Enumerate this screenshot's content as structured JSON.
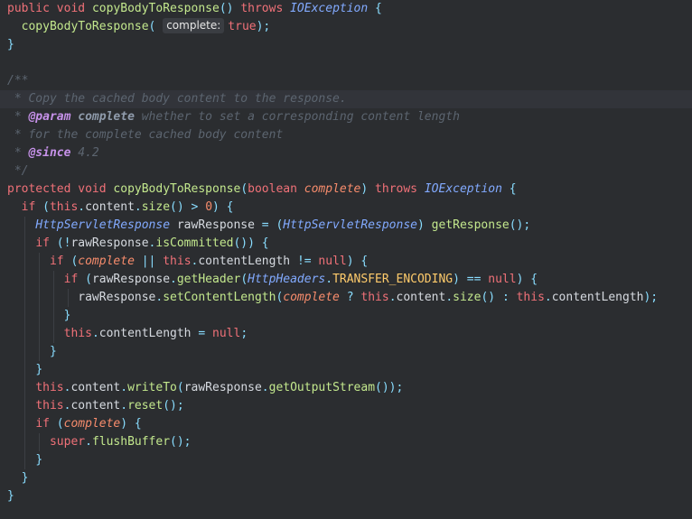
{
  "editor": {
    "theme_colors": {
      "background": "#2b2d30",
      "keyword": "#f07178",
      "method": "#c3e88d",
      "type": "#82aaff",
      "comment": "#5c6570",
      "javadoc_tag": "#c792ea"
    },
    "lines": [
      {
        "indent": 0,
        "tokens": [
          {
            "c": "kw",
            "t": "public"
          },
          {
            "c": "",
            "t": " "
          },
          {
            "c": "kw",
            "t": "void"
          },
          {
            "c": "",
            "t": " "
          },
          {
            "c": "fn",
            "t": "copyBodyToResponse"
          },
          {
            "c": "pu",
            "t": "()"
          },
          {
            "c": "",
            "t": " "
          },
          {
            "c": "kw",
            "t": "throws"
          },
          {
            "c": "",
            "t": " "
          },
          {
            "c": "ty",
            "t": "IOException"
          },
          {
            "c": "",
            "t": " "
          },
          {
            "c": "pu",
            "t": "{"
          }
        ]
      },
      {
        "indent": 1,
        "tokens": [
          {
            "c": "fn",
            "t": "copyBodyToResponse"
          },
          {
            "c": "pu",
            "t": "( "
          },
          {
            "c": "hint",
            "t": "complete:"
          },
          {
            "c": "kw",
            "t": "true"
          },
          {
            "c": "pu",
            "t": ");"
          }
        ]
      },
      {
        "indent": 0,
        "tokens": [
          {
            "c": "pu",
            "t": "}"
          }
        ]
      },
      {
        "indent": 0,
        "tokens": []
      },
      {
        "indent": 0,
        "tokens": [
          {
            "c": "cm",
            "t": "/**"
          }
        ]
      },
      {
        "indent": 0,
        "highlight": true,
        "tokens": [
          {
            "c": "cm",
            "t": " * Copy the cached body content to the response."
          }
        ]
      },
      {
        "indent": 0,
        "tokens": [
          {
            "c": "cm",
            "t": " * "
          },
          {
            "c": "tg",
            "t": "@param"
          },
          {
            "c": "",
            "t": " "
          },
          {
            "c": "tp",
            "t": "complete"
          },
          {
            "c": "cm",
            "t": " whether to set a corresponding content length"
          }
        ]
      },
      {
        "indent": 0,
        "tokens": [
          {
            "c": "cm",
            "t": " * for the complete cached body content"
          }
        ]
      },
      {
        "indent": 0,
        "tokens": [
          {
            "c": "cm",
            "t": " * "
          },
          {
            "c": "tg",
            "t": "@since"
          },
          {
            "c": "cm",
            "t": " 4.2"
          }
        ]
      },
      {
        "indent": 0,
        "tokens": [
          {
            "c": "cm",
            "t": " */"
          }
        ]
      },
      {
        "indent": 0,
        "tokens": [
          {
            "c": "kw",
            "t": "protected"
          },
          {
            "c": "",
            "t": " "
          },
          {
            "c": "kw",
            "t": "void"
          },
          {
            "c": "",
            "t": " "
          },
          {
            "c": "fn",
            "t": "copyBodyToResponse"
          },
          {
            "c": "pu",
            "t": "("
          },
          {
            "c": "kw",
            "t": "boolean"
          },
          {
            "c": "",
            "t": " "
          },
          {
            "c": "pr",
            "t": "complete"
          },
          {
            "c": "pu",
            "t": ")"
          },
          {
            "c": "",
            "t": " "
          },
          {
            "c": "kw",
            "t": "throws"
          },
          {
            "c": "",
            "t": " "
          },
          {
            "c": "ty",
            "t": "IOException"
          },
          {
            "c": "",
            "t": " "
          },
          {
            "c": "pu",
            "t": "{"
          }
        ]
      },
      {
        "indent": 1,
        "tokens": [
          {
            "c": "kw",
            "t": "if"
          },
          {
            "c": "",
            "t": " "
          },
          {
            "c": "pu",
            "t": "("
          },
          {
            "c": "kw",
            "t": "this"
          },
          {
            "c": "pu",
            "t": "."
          },
          {
            "c": "id",
            "t": "content"
          },
          {
            "c": "pu",
            "t": "."
          },
          {
            "c": "fn",
            "t": "size"
          },
          {
            "c": "pu",
            "t": "()"
          },
          {
            "c": "",
            "t": " "
          },
          {
            "c": "op",
            "t": ">"
          },
          {
            "c": "",
            "t": " "
          },
          {
            "c": "num",
            "t": "0"
          },
          {
            "c": "pu",
            "t": ")"
          },
          {
            "c": "",
            "t": " "
          },
          {
            "c": "pu",
            "t": "{"
          }
        ]
      },
      {
        "indent": 2,
        "tokens": [
          {
            "c": "ty",
            "t": "HttpServletResponse"
          },
          {
            "c": "",
            "t": " "
          },
          {
            "c": "id",
            "t": "rawResponse"
          },
          {
            "c": "",
            "t": " "
          },
          {
            "c": "op",
            "t": "="
          },
          {
            "c": "",
            "t": " "
          },
          {
            "c": "pu",
            "t": "("
          },
          {
            "c": "ty",
            "t": "HttpServletResponse"
          },
          {
            "c": "pu",
            "t": ")"
          },
          {
            "c": "",
            "t": " "
          },
          {
            "c": "fn",
            "t": "getResponse"
          },
          {
            "c": "pu",
            "t": "();"
          }
        ]
      },
      {
        "indent": 2,
        "tokens": [
          {
            "c": "kw",
            "t": "if"
          },
          {
            "c": "",
            "t": " "
          },
          {
            "c": "pu",
            "t": "("
          },
          {
            "c": "op",
            "t": "!"
          },
          {
            "c": "id",
            "t": "rawResponse"
          },
          {
            "c": "pu",
            "t": "."
          },
          {
            "c": "fn",
            "t": "isCommitted"
          },
          {
            "c": "pu",
            "t": "())"
          },
          {
            "c": "",
            "t": " "
          },
          {
            "c": "pu",
            "t": "{"
          }
        ]
      },
      {
        "indent": 3,
        "tokens": [
          {
            "c": "kw",
            "t": "if"
          },
          {
            "c": "",
            "t": " "
          },
          {
            "c": "pu",
            "t": "("
          },
          {
            "c": "pr",
            "t": "complete"
          },
          {
            "c": "",
            "t": " "
          },
          {
            "c": "op",
            "t": "||"
          },
          {
            "c": "",
            "t": " "
          },
          {
            "c": "kw",
            "t": "this"
          },
          {
            "c": "pu",
            "t": "."
          },
          {
            "c": "id",
            "t": "contentLength"
          },
          {
            "c": "",
            "t": " "
          },
          {
            "c": "op",
            "t": "!="
          },
          {
            "c": "",
            "t": " "
          },
          {
            "c": "kw",
            "t": "null"
          },
          {
            "c": "pu",
            "t": ")"
          },
          {
            "c": "",
            "t": " "
          },
          {
            "c": "pu",
            "t": "{"
          }
        ]
      },
      {
        "indent": 4,
        "tokens": [
          {
            "c": "kw",
            "t": "if"
          },
          {
            "c": "",
            "t": " "
          },
          {
            "c": "pu",
            "t": "("
          },
          {
            "c": "id",
            "t": "rawResponse"
          },
          {
            "c": "pu",
            "t": "."
          },
          {
            "c": "fn",
            "t": "getHeader"
          },
          {
            "c": "pu",
            "t": "("
          },
          {
            "c": "ty",
            "t": "HttpHeaders"
          },
          {
            "c": "pu",
            "t": "."
          },
          {
            "c": "cs",
            "t": "TRANSFER_ENCODING"
          },
          {
            "c": "pu",
            "t": ")"
          },
          {
            "c": "",
            "t": " "
          },
          {
            "c": "op",
            "t": "=="
          },
          {
            "c": "",
            "t": " "
          },
          {
            "c": "kw",
            "t": "null"
          },
          {
            "c": "pu",
            "t": ")"
          },
          {
            "c": "",
            "t": " "
          },
          {
            "c": "pu",
            "t": "{"
          }
        ]
      },
      {
        "indent": 5,
        "tokens": [
          {
            "c": "id",
            "t": "rawResponse"
          },
          {
            "c": "pu",
            "t": "."
          },
          {
            "c": "fn",
            "t": "setContentLength"
          },
          {
            "c": "pu",
            "t": "("
          },
          {
            "c": "pr",
            "t": "complete"
          },
          {
            "c": "",
            "t": " "
          },
          {
            "c": "op",
            "t": "?"
          },
          {
            "c": "",
            "t": " "
          },
          {
            "c": "kw",
            "t": "this"
          },
          {
            "c": "pu",
            "t": "."
          },
          {
            "c": "id",
            "t": "content"
          },
          {
            "c": "pu",
            "t": "."
          },
          {
            "c": "fn",
            "t": "size"
          },
          {
            "c": "pu",
            "t": "()"
          },
          {
            "c": "",
            "t": " "
          },
          {
            "c": "op",
            "t": ":"
          },
          {
            "c": "",
            "t": " "
          },
          {
            "c": "kw",
            "t": "this"
          },
          {
            "c": "pu",
            "t": "."
          },
          {
            "c": "id",
            "t": "contentLength"
          },
          {
            "c": "pu",
            "t": ");"
          }
        ]
      },
      {
        "indent": 4,
        "tokens": [
          {
            "c": "pu",
            "t": "}"
          }
        ]
      },
      {
        "indent": 4,
        "tokens": [
          {
            "c": "kw",
            "t": "this"
          },
          {
            "c": "pu",
            "t": "."
          },
          {
            "c": "id",
            "t": "contentLength"
          },
          {
            "c": "",
            "t": " "
          },
          {
            "c": "op",
            "t": "="
          },
          {
            "c": "",
            "t": " "
          },
          {
            "c": "kw",
            "t": "null"
          },
          {
            "c": "pu",
            "t": ";"
          }
        ]
      },
      {
        "indent": 3,
        "tokens": [
          {
            "c": "pu",
            "t": "}"
          }
        ]
      },
      {
        "indent": 2,
        "tokens": [
          {
            "c": "pu",
            "t": "}"
          }
        ]
      },
      {
        "indent": 2,
        "tokens": [
          {
            "c": "kw",
            "t": "this"
          },
          {
            "c": "pu",
            "t": "."
          },
          {
            "c": "id",
            "t": "content"
          },
          {
            "c": "pu",
            "t": "."
          },
          {
            "c": "fn",
            "t": "writeTo"
          },
          {
            "c": "pu",
            "t": "("
          },
          {
            "c": "id",
            "t": "rawResponse"
          },
          {
            "c": "pu",
            "t": "."
          },
          {
            "c": "fn",
            "t": "getOutputStream"
          },
          {
            "c": "pu",
            "t": "());"
          }
        ]
      },
      {
        "indent": 2,
        "tokens": [
          {
            "c": "kw",
            "t": "this"
          },
          {
            "c": "pu",
            "t": "."
          },
          {
            "c": "id",
            "t": "content"
          },
          {
            "c": "pu",
            "t": "."
          },
          {
            "c": "fn",
            "t": "reset"
          },
          {
            "c": "pu",
            "t": "();"
          }
        ]
      },
      {
        "indent": 2,
        "tokens": [
          {
            "c": "kw",
            "t": "if"
          },
          {
            "c": "",
            "t": " "
          },
          {
            "c": "pu",
            "t": "("
          },
          {
            "c": "pr",
            "t": "complete"
          },
          {
            "c": "pu",
            "t": ")"
          },
          {
            "c": "",
            "t": " "
          },
          {
            "c": "pu",
            "t": "{"
          }
        ]
      },
      {
        "indent": 3,
        "tokens": [
          {
            "c": "kw",
            "t": "super"
          },
          {
            "c": "pu",
            "t": "."
          },
          {
            "c": "fn",
            "t": "flushBuffer"
          },
          {
            "c": "pu",
            "t": "();"
          }
        ]
      },
      {
        "indent": 2,
        "tokens": [
          {
            "c": "pu",
            "t": "}"
          }
        ]
      },
      {
        "indent": 1,
        "tokens": [
          {
            "c": "pu",
            "t": "}"
          }
        ]
      },
      {
        "indent": 0,
        "tokens": [
          {
            "c": "pu",
            "t": "}"
          }
        ]
      }
    ]
  }
}
